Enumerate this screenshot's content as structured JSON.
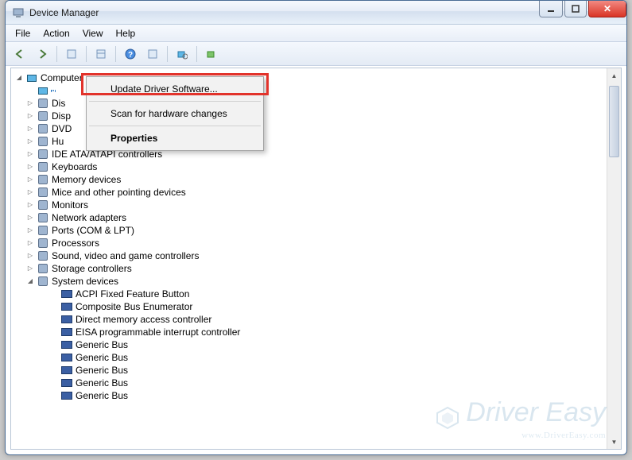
{
  "window": {
    "title": "Device Manager"
  },
  "menubar": [
    "File",
    "Action",
    "View",
    "Help"
  ],
  "toolbar_icons": [
    "back",
    "forward",
    "show-hidden",
    "properties",
    "help",
    "update",
    "scan",
    "uninstall"
  ],
  "tree": {
    "root": {
      "label": "Computer",
      "expanded": true
    },
    "selected_child": {
      "label": ""
    },
    "categories": [
      {
        "label": "Dis",
        "expander": "▷"
      },
      {
        "label": "Disp",
        "expander": "▷"
      },
      {
        "label": "DVD",
        "expander": "▷"
      },
      {
        "label": "Hu",
        "expander": "▷"
      },
      {
        "label": "IDE ATA/ATAPI controllers",
        "expander": "▷"
      },
      {
        "label": "Keyboards",
        "expander": "▷"
      },
      {
        "label": "Memory devices",
        "expander": "▷"
      },
      {
        "label": "Mice and other pointing devices",
        "expander": "▷"
      },
      {
        "label": "Monitors",
        "expander": "▷"
      },
      {
        "label": "Network adapters",
        "expander": "▷"
      },
      {
        "label": "Ports (COM & LPT)",
        "expander": "▷"
      },
      {
        "label": "Processors",
        "expander": "▷"
      },
      {
        "label": "Sound, video and game controllers",
        "expander": "▷"
      },
      {
        "label": "Storage controllers",
        "expander": "▷"
      },
      {
        "label": "System devices",
        "expander": "▲",
        "expanded": true,
        "children": [
          "ACPI Fixed Feature Button",
          "Composite Bus Enumerator",
          "Direct memory access controller",
          "EISA programmable interrupt controller",
          "Generic Bus",
          "Generic Bus",
          "Generic Bus",
          "Generic Bus",
          "Generic Bus"
        ]
      }
    ]
  },
  "context_menu": {
    "items": [
      {
        "label": "Update Driver Software...",
        "highlighted": true
      },
      {
        "sep": true
      },
      {
        "label": "Scan for hardware changes"
      },
      {
        "sep": true
      },
      {
        "label": "Properties",
        "bold": true
      }
    ]
  },
  "watermark": {
    "brand": "Driver Easy",
    "url": "www.DriverEasy.com"
  }
}
